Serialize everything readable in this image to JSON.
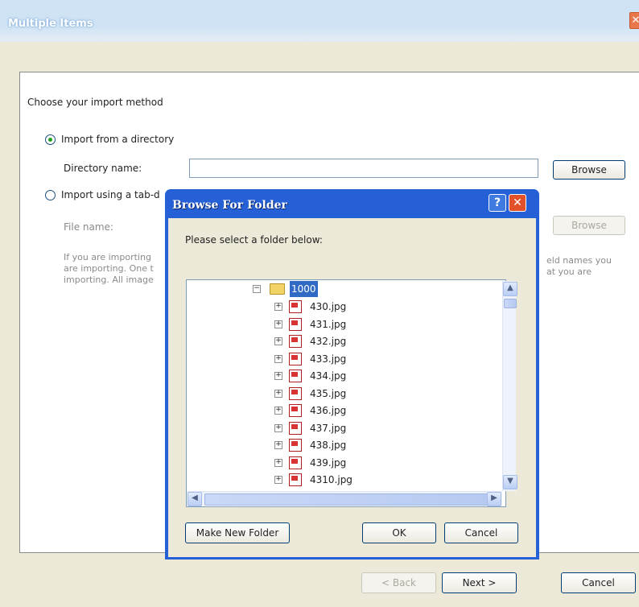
{
  "window": {
    "title": "Multiple Items",
    "close_glyph": "✕"
  },
  "import": {
    "heading": "Choose your import method",
    "option_directory": "Import from a directory",
    "directory_label": "Directory name:",
    "directory_value": "",
    "browse_label": "Browse",
    "option_file": "Import using a tab-d",
    "file_label": "File name:",
    "file_browse_label": "Browse",
    "desc_left": [
      "If you are importing",
      "are importing. One t",
      "importing. All image"
    ],
    "desc_right": [
      "eld names you",
      "at you are"
    ]
  },
  "footer": {
    "back_label": "< Back",
    "next_label": "Next >",
    "cancel_label": "Cancel"
  },
  "dialog": {
    "title": "Browse For Folder",
    "help_glyph": "?",
    "close_glyph": "✕",
    "instruction": "Please select a folder below:",
    "folder": "1000",
    "files": [
      "430.jpg",
      "431.jpg",
      "432.jpg",
      "433.jpg",
      "434.jpg",
      "435.jpg",
      "436.jpg",
      "437.jpg",
      "438.jpg",
      "439.jpg",
      "4310.jpg"
    ],
    "make_folder_label": "Make New Folder",
    "ok_label": "OK",
    "cancel_label": "Cancel"
  },
  "colors": {
    "dialog_frame": "#2660d6",
    "selection": "#316ac5",
    "radio_dot": "#21a121"
  }
}
